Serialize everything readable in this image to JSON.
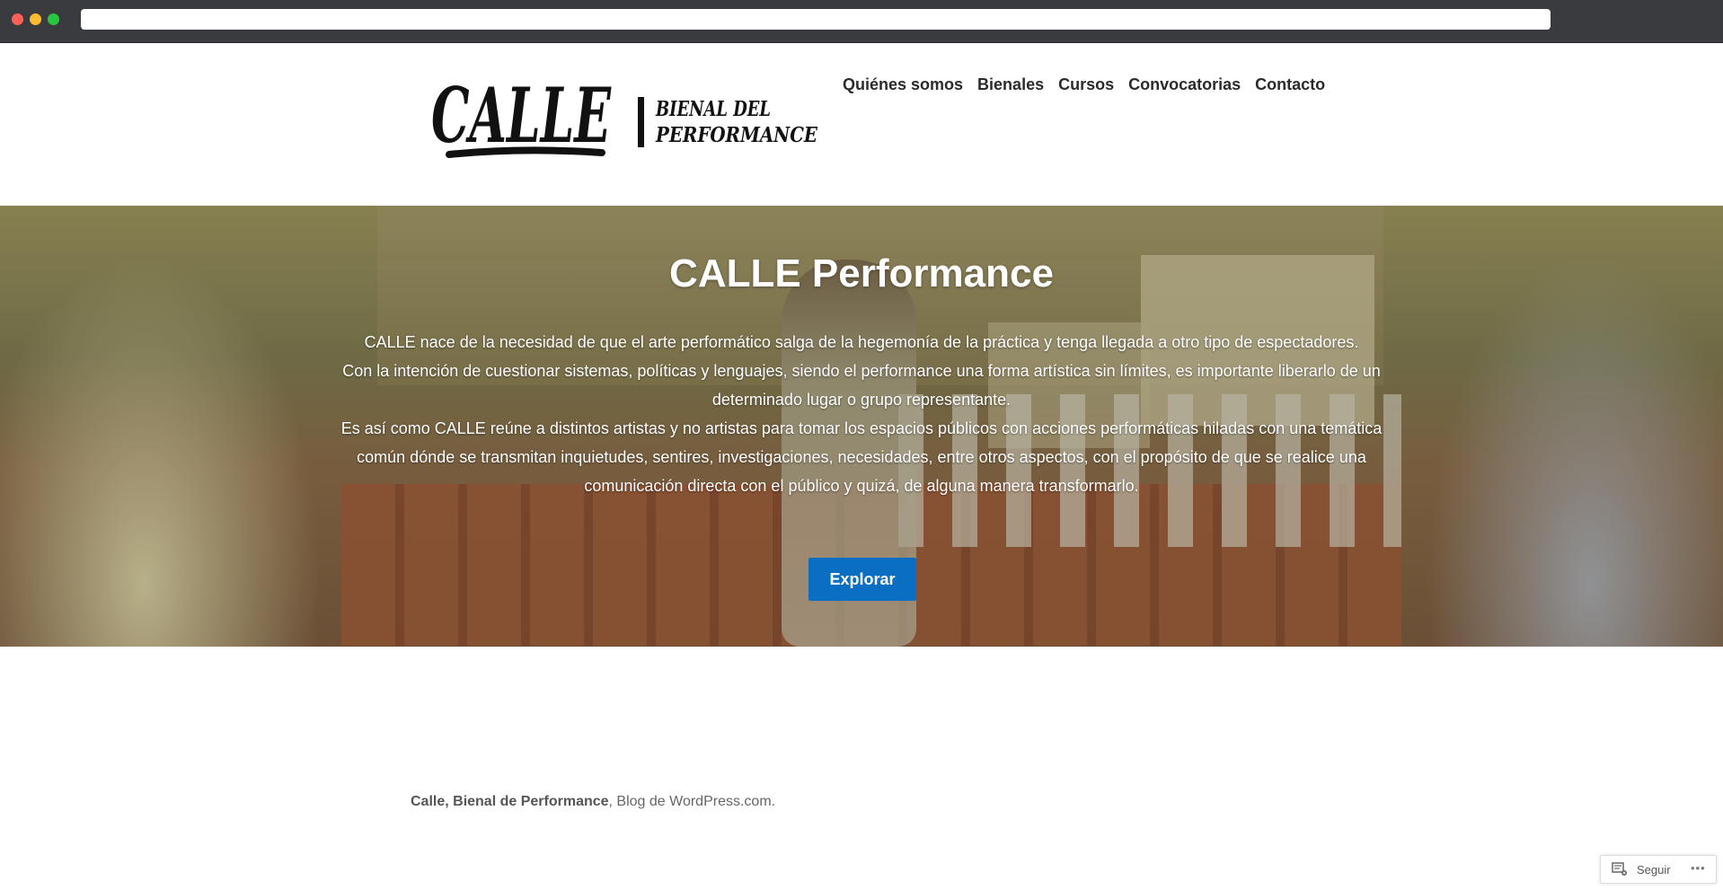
{
  "browser": {
    "url": ""
  },
  "header": {
    "logo_text_main": "CALLE",
    "logo_text_sub1": "BIENAL DEL",
    "logo_text_sub2": "PERFORMANCE",
    "nav": [
      "Quiénes somos",
      "Bienales",
      "Cursos",
      "Convocatorias",
      "Contacto"
    ]
  },
  "hero": {
    "title": "CALLE Performance",
    "paragraphs": [
      "CALLE nace de la necesidad de que el arte performático salga de la hegemonía de la práctica y tenga llegada a otro tipo de espectadores.",
      "Con la intención de cuestionar sistemas, políticas y lenguajes, siendo el performance una forma artística sin límites, es importante liberarlo de un determinado lugar o grupo representante.",
      "Es así como CALLE reúne a distintos artistas y no artistas para tomar los espacios públicos con acciones performáticas hiladas con una temática común dónde se transmitan inquietudes, sentires, investigaciones, necesidades, entre otros aspectos, con el propósito de que se realice una comunicación directa con el público y quizá, de alguna manera transformarlo."
    ],
    "button_label": "Explorar"
  },
  "footer": {
    "site_name": "Calle, Bienal de Performance",
    "separator": ", ",
    "wp_link": "Blog de WordPress.com",
    "end": "."
  },
  "follow_widget": {
    "label": "Seguir",
    "more": "•••"
  },
  "colors": {
    "button": "#0a6fc2",
    "chrome": "#3a3b3e"
  }
}
